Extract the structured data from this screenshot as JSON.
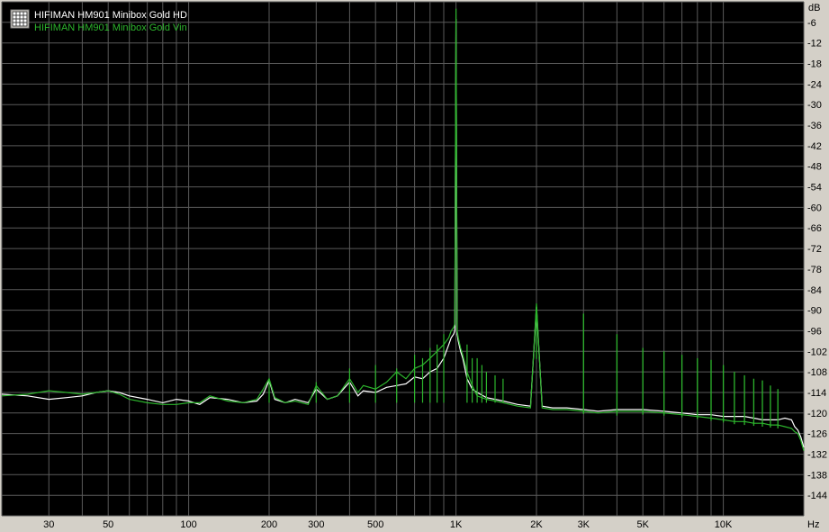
{
  "chart_data": {
    "type": "line",
    "title": "",
    "xlabel": "",
    "ylabel": "",
    "x_scale": "log",
    "x_unit": "Hz",
    "y_unit": "dB",
    "xlim": [
      20,
      20000
    ],
    "ylim": [
      -150,
      0
    ],
    "grid": true,
    "legend_position": "top-left",
    "x_ticks": [
      {
        "value": 30,
        "label": "30"
      },
      {
        "value": 50,
        "label": "50"
      },
      {
        "value": 100,
        "label": "100"
      },
      {
        "value": 200,
        "label": "200"
      },
      {
        "value": 300,
        "label": "300"
      },
      {
        "value": 500,
        "label": "500"
      },
      {
        "value": 1000,
        "label": "1K"
      },
      {
        "value": 2000,
        "label": "2K"
      },
      {
        "value": 3000,
        "label": "3K"
      },
      {
        "value": 5000,
        "label": "5K"
      },
      {
        "value": 10000,
        "label": "10K"
      }
    ],
    "y_ticks": [
      {
        "value": -6,
        "label": "-6"
      },
      {
        "value": -12,
        "label": "-12"
      },
      {
        "value": -18,
        "label": "-18"
      },
      {
        "value": -24,
        "label": "-24"
      },
      {
        "value": -30,
        "label": "-30"
      },
      {
        "value": -36,
        "label": "-36"
      },
      {
        "value": -42,
        "label": "-42"
      },
      {
        "value": -48,
        "label": "-48"
      },
      {
        "value": -54,
        "label": "-54"
      },
      {
        "value": -60,
        "label": "-60"
      },
      {
        "value": -66,
        "label": "-66"
      },
      {
        "value": -72,
        "label": "-72"
      },
      {
        "value": -78,
        "label": "-78"
      },
      {
        "value": -84,
        "label": "-84"
      },
      {
        "value": -90,
        "label": "-90"
      },
      {
        "value": -96,
        "label": "-96"
      },
      {
        "value": -102,
        "label": "-102"
      },
      {
        "value": -108,
        "label": "-108"
      },
      {
        "value": -114,
        "label": "-114"
      },
      {
        "value": -120,
        "label": "-120"
      },
      {
        "value": -126,
        "label": "-126"
      },
      {
        "value": -132,
        "label": "-132"
      },
      {
        "value": -138,
        "label": "-138"
      },
      {
        "value": -144,
        "label": "-144"
      }
    ],
    "series": [
      {
        "name": "HIFIMAN HM901 Minibox Gold HD",
        "color": "#ffffff",
        "x": [
          20,
          25,
          30,
          35,
          40,
          45,
          50,
          55,
          60,
          70,
          80,
          90,
          100,
          110,
          120,
          140,
          160,
          180,
          190,
          200,
          210,
          230,
          250,
          280,
          300,
          330,
          360,
          400,
          430,
          450,
          500,
          550,
          600,
          650,
          700,
          750,
          800,
          850,
          900,
          940,
          960,
          980,
          990,
          1000,
          1010,
          1020,
          1040,
          1060,
          1100,
          1150,
          1200,
          1300,
          1400,
          1500,
          1700,
          1900,
          2000,
          2100,
          2300,
          2600,
          3000,
          3400,
          4000,
          4500,
          5000,
          6000,
          7000,
          8000,
          9000,
          10000,
          11000,
          12000,
          13000,
          14000,
          15000,
          16000,
          17000,
          18000,
          18500,
          19000,
          19500,
          20000
        ],
        "y": [
          -114.5,
          -115,
          -116,
          -115.5,
          -115,
          -114,
          -113.5,
          -114,
          -115,
          -116,
          -117,
          -116,
          -116.5,
          -117.5,
          -115.5,
          -116,
          -117,
          -116.5,
          -114.5,
          -110.5,
          -116,
          -117,
          -116,
          -117,
          -113,
          -116,
          -115,
          -111,
          -115,
          -113.5,
          -114,
          -112.5,
          -112,
          -111.5,
          -109.5,
          -110,
          -108,
          -107,
          -104,
          -100,
          -98,
          -97,
          -96,
          -5,
          -97,
          -99,
          -102,
          -104,
          -110,
          -113,
          -114,
          -115.5,
          -116,
          -116.5,
          -117.5,
          -118,
          -89,
          -118,
          -118.5,
          -118.5,
          -119,
          -119.5,
          -119,
          -119,
          -119,
          -119.5,
          -120,
          -120.5,
          -120.5,
          -121,
          -121,
          -121,
          -121.5,
          -122,
          -122,
          -122,
          -121.5,
          -122,
          -124,
          -125,
          -127,
          -130
        ]
      },
      {
        "name": "HIFIMAN HM901 Minibox  Gold Vin",
        "color": "#2db52d",
        "x": [
          20,
          25,
          30,
          35,
          40,
          45,
          50,
          55,
          60,
          70,
          80,
          90,
          100,
          110,
          120,
          140,
          160,
          180,
          190,
          200,
          210,
          230,
          250,
          280,
          300,
          330,
          360,
          400,
          430,
          450,
          500,
          550,
          600,
          650,
          700,
          750,
          800,
          850,
          900,
          940,
          960,
          980,
          990,
          1000,
          1010,
          1020,
          1040,
          1060,
          1100,
          1150,
          1200,
          1300,
          1400,
          1500,
          1700,
          1900,
          2000,
          2100,
          2300,
          2600,
          3000,
          3400,
          4000,
          4500,
          5000,
          6000,
          7000,
          8000,
          9000,
          10000,
          11000,
          12000,
          13000,
          14000,
          15000,
          16000,
          17000,
          18000,
          18500,
          19000,
          19500,
          20000
        ],
        "y": [
          -115,
          -114.5,
          -113.5,
          -114,
          -114.5,
          -114,
          -113.5,
          -114.5,
          -116,
          -117,
          -117.5,
          -117.5,
          -117,
          -117,
          -115,
          -116.5,
          -117,
          -116,
          -113,
          -110,
          -115.5,
          -117,
          -116.5,
          -117.5,
          -112,
          -116,
          -115,
          -110,
          -114,
          -112,
          -113,
          -111,
          -108,
          -110,
          -107,
          -106,
          -104,
          -102,
          -100,
          -98,
          -96,
          -95,
          -94,
          -2,
          -96,
          -98,
          -101,
          -103,
          -108,
          -112,
          -115,
          -116,
          -116.5,
          -117,
          -118,
          -118.5,
          -88,
          -118.5,
          -119,
          -119,
          -119.5,
          -120,
          -119.5,
          -119.5,
          -119.5,
          -120,
          -120.5,
          -121,
          -121.5,
          -122,
          -122.5,
          -122.5,
          -123,
          -123,
          -123.5,
          -123.5,
          -124,
          -124.5,
          -125.5,
          -126,
          -128,
          -131
        ]
      }
    ],
    "harmonic_peaks": {
      "x": [
        2000,
        3000,
        4000,
        5000,
        6000,
        7000,
        8000,
        9000,
        10000,
        11000,
        12000,
        13000,
        14000,
        15000,
        16000
      ],
      "y": [
        -89,
        -91,
        -97,
        -101,
        -102,
        -103,
        -104,
        -104.5,
        -106,
        -108,
        -109,
        -110,
        -110.5,
        -112,
        -113
      ]
    },
    "low_freq_spurs": {
      "x": [
        200,
        300,
        400,
        500,
        600,
        700,
        750,
        800,
        850,
        900,
        1100,
        1150,
        1200,
        1250,
        1300,
        1400,
        1500
      ],
      "y": [
        -110,
        -111,
        -107,
        -106,
        -107,
        -103,
        -104,
        -101,
        -100,
        -97,
        -100,
        -104,
        -104,
        -106,
        -108,
        -109,
        -110
      ]
    }
  }
}
